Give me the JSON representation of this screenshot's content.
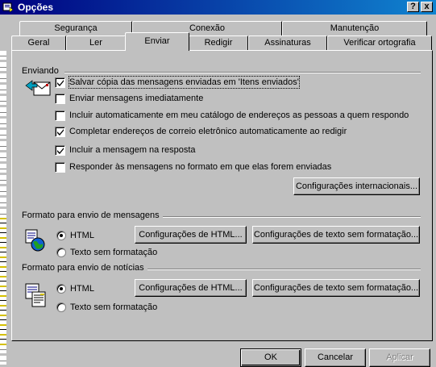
{
  "window": {
    "title": "Opções",
    "help_label": "?",
    "close_label": "x"
  },
  "tabs_back": [
    "Segurança",
    "Conexão",
    "Manutenção"
  ],
  "tabs_front": [
    "Geral",
    "Ler",
    "Enviar",
    "Redigir",
    "Assinaturas",
    "Verificar ortografia"
  ],
  "active_tab": "Enviar",
  "sending": {
    "group_label": "Enviando",
    "options": [
      {
        "label": "Salvar cópia das mensagens enviadas em 'Itens enviados'",
        "checked": true
      },
      {
        "label": "Enviar mensagens imediatamente",
        "checked": false
      },
      {
        "label": "Incluir automaticamente em meu catálogo de endereços as pessoas a quem respondo",
        "checked": false
      },
      {
        "label": "Completar endereços de correio eletrônico automaticamente ao redigir",
        "checked": true
      },
      {
        "label": "Incluir a mensagem na resposta",
        "checked": true
      },
      {
        "label": "Responder às mensagens no formato em que elas forem enviadas",
        "checked": false
      }
    ],
    "intl_button": "Configurações internacionais..."
  },
  "mail_format": {
    "group_label": "Formato para envio de mensagens",
    "html_label": "HTML",
    "plain_label": "Texto sem formatação",
    "selected": "HTML",
    "html_settings_button": "Configurações de HTML...",
    "plain_settings_button": "Configurações de texto sem formatação..."
  },
  "news_format": {
    "group_label": "Formato para envio de notícias",
    "html_label": "HTML",
    "plain_label": "Texto sem formatação",
    "selected": "HTML",
    "html_settings_button": "Configurações de HTML...",
    "plain_settings_button": "Configurações de texto sem formatação..."
  },
  "footer": {
    "ok": "OK",
    "cancel": "Cancelar",
    "apply": "Aplicar",
    "apply_enabled": false
  }
}
